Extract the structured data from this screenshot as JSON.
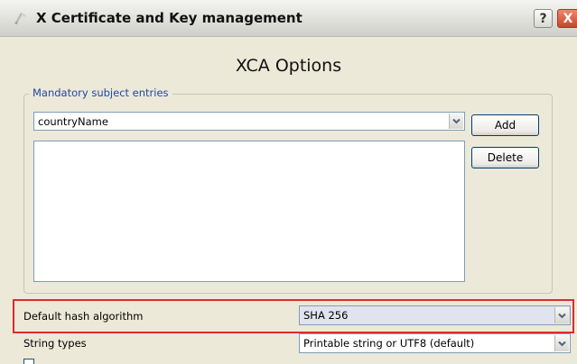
{
  "window": {
    "title": "X Certificate and Key management",
    "help_label": "?",
    "close_label": "X"
  },
  "dialog": {
    "heading": "XCA Options"
  },
  "mandatory_entries": {
    "legend": "Mandatory subject entries",
    "selected_field": "countryName",
    "add_label": "Add",
    "delete_label": "Delete",
    "items": []
  },
  "hash": {
    "label": "Default hash algorithm",
    "value": "SHA 256"
  },
  "string_types": {
    "label": "String types",
    "value": "Printable string or UTF8 (default)"
  },
  "icons": {
    "title": "certificate-icon",
    "dropdown": "chevron-down-icon"
  },
  "colors": {
    "highlight": "#e02b2b",
    "legend_text": "#1f47a6",
    "input_border": "#7f9db9"
  }
}
